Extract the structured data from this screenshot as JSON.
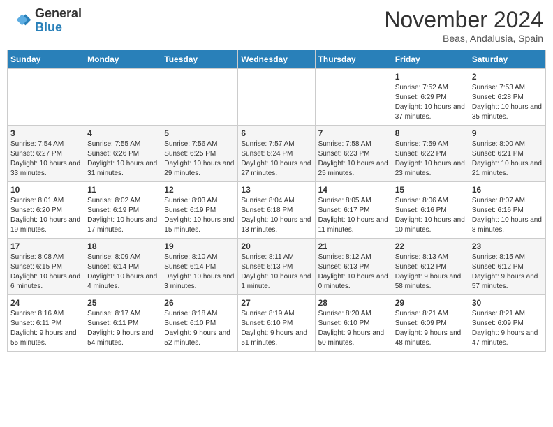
{
  "logo": {
    "text_general": "General",
    "text_blue": "Blue"
  },
  "header": {
    "month": "November 2024",
    "location": "Beas, Andalusia, Spain"
  },
  "days_of_week": [
    "Sunday",
    "Monday",
    "Tuesday",
    "Wednesday",
    "Thursday",
    "Friday",
    "Saturday"
  ],
  "weeks": [
    [
      {
        "day": "",
        "info": ""
      },
      {
        "day": "",
        "info": ""
      },
      {
        "day": "",
        "info": ""
      },
      {
        "day": "",
        "info": ""
      },
      {
        "day": "",
        "info": ""
      },
      {
        "day": "1",
        "info": "Sunrise: 7:52 AM\nSunset: 6:29 PM\nDaylight: 10 hours and 37 minutes."
      },
      {
        "day": "2",
        "info": "Sunrise: 7:53 AM\nSunset: 6:28 PM\nDaylight: 10 hours and 35 minutes."
      }
    ],
    [
      {
        "day": "3",
        "info": "Sunrise: 7:54 AM\nSunset: 6:27 PM\nDaylight: 10 hours and 33 minutes."
      },
      {
        "day": "4",
        "info": "Sunrise: 7:55 AM\nSunset: 6:26 PM\nDaylight: 10 hours and 31 minutes."
      },
      {
        "day": "5",
        "info": "Sunrise: 7:56 AM\nSunset: 6:25 PM\nDaylight: 10 hours and 29 minutes."
      },
      {
        "day": "6",
        "info": "Sunrise: 7:57 AM\nSunset: 6:24 PM\nDaylight: 10 hours and 27 minutes."
      },
      {
        "day": "7",
        "info": "Sunrise: 7:58 AM\nSunset: 6:23 PM\nDaylight: 10 hours and 25 minutes."
      },
      {
        "day": "8",
        "info": "Sunrise: 7:59 AM\nSunset: 6:22 PM\nDaylight: 10 hours and 23 minutes."
      },
      {
        "day": "9",
        "info": "Sunrise: 8:00 AM\nSunset: 6:21 PM\nDaylight: 10 hours and 21 minutes."
      }
    ],
    [
      {
        "day": "10",
        "info": "Sunrise: 8:01 AM\nSunset: 6:20 PM\nDaylight: 10 hours and 19 minutes."
      },
      {
        "day": "11",
        "info": "Sunrise: 8:02 AM\nSunset: 6:19 PM\nDaylight: 10 hours and 17 minutes."
      },
      {
        "day": "12",
        "info": "Sunrise: 8:03 AM\nSunset: 6:19 PM\nDaylight: 10 hours and 15 minutes."
      },
      {
        "day": "13",
        "info": "Sunrise: 8:04 AM\nSunset: 6:18 PM\nDaylight: 10 hours and 13 minutes."
      },
      {
        "day": "14",
        "info": "Sunrise: 8:05 AM\nSunset: 6:17 PM\nDaylight: 10 hours and 11 minutes."
      },
      {
        "day": "15",
        "info": "Sunrise: 8:06 AM\nSunset: 6:16 PM\nDaylight: 10 hours and 10 minutes."
      },
      {
        "day": "16",
        "info": "Sunrise: 8:07 AM\nSunset: 6:16 PM\nDaylight: 10 hours and 8 minutes."
      }
    ],
    [
      {
        "day": "17",
        "info": "Sunrise: 8:08 AM\nSunset: 6:15 PM\nDaylight: 10 hours and 6 minutes."
      },
      {
        "day": "18",
        "info": "Sunrise: 8:09 AM\nSunset: 6:14 PM\nDaylight: 10 hours and 4 minutes."
      },
      {
        "day": "19",
        "info": "Sunrise: 8:10 AM\nSunset: 6:14 PM\nDaylight: 10 hours and 3 minutes."
      },
      {
        "day": "20",
        "info": "Sunrise: 8:11 AM\nSunset: 6:13 PM\nDaylight: 10 hours and 1 minute."
      },
      {
        "day": "21",
        "info": "Sunrise: 8:12 AM\nSunset: 6:13 PM\nDaylight: 10 hours and 0 minutes."
      },
      {
        "day": "22",
        "info": "Sunrise: 8:13 AM\nSunset: 6:12 PM\nDaylight: 9 hours and 58 minutes."
      },
      {
        "day": "23",
        "info": "Sunrise: 8:15 AM\nSunset: 6:12 PM\nDaylight: 9 hours and 57 minutes."
      }
    ],
    [
      {
        "day": "24",
        "info": "Sunrise: 8:16 AM\nSunset: 6:11 PM\nDaylight: 9 hours and 55 minutes."
      },
      {
        "day": "25",
        "info": "Sunrise: 8:17 AM\nSunset: 6:11 PM\nDaylight: 9 hours and 54 minutes."
      },
      {
        "day": "26",
        "info": "Sunrise: 8:18 AM\nSunset: 6:10 PM\nDaylight: 9 hours and 52 minutes."
      },
      {
        "day": "27",
        "info": "Sunrise: 8:19 AM\nSunset: 6:10 PM\nDaylight: 9 hours and 51 minutes."
      },
      {
        "day": "28",
        "info": "Sunrise: 8:20 AM\nSunset: 6:10 PM\nDaylight: 9 hours and 50 minutes."
      },
      {
        "day": "29",
        "info": "Sunrise: 8:21 AM\nSunset: 6:09 PM\nDaylight: 9 hours and 48 minutes."
      },
      {
        "day": "30",
        "info": "Sunrise: 8:21 AM\nSunset: 6:09 PM\nDaylight: 9 hours and 47 minutes."
      }
    ]
  ]
}
